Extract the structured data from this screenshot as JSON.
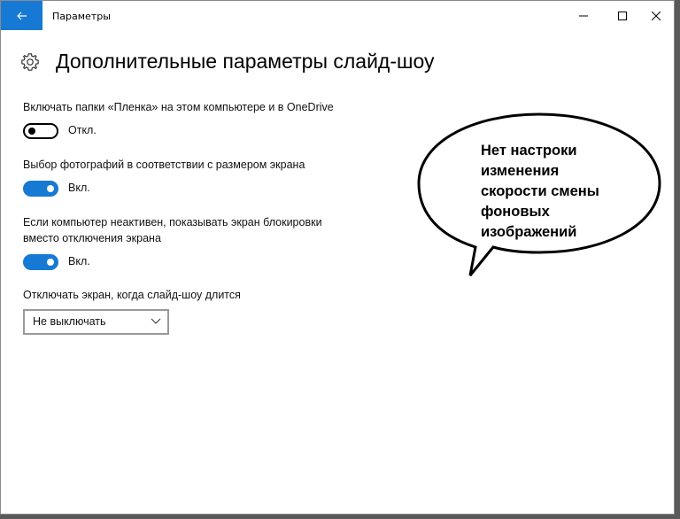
{
  "window": {
    "title": "Параметры"
  },
  "page": {
    "title": "Дополнительные параметры слайд-шоу"
  },
  "settings": [
    {
      "label": "Включать папки «Пленка» на этом компьютере и в OneDrive",
      "state": "Откл.",
      "on": false
    },
    {
      "label": "Выбор фотографий в соответствии с размером экрана",
      "state": "Вкл.",
      "on": true
    },
    {
      "label": "Если компьютер неактивен, показывать экран блокировки",
      "label2": "вместо отключения экрана",
      "state": "Вкл.",
      "on": true
    }
  ],
  "screen_off": {
    "label": "Отключать экран, когда слайд-шоу длится",
    "selected": "Не выключать"
  },
  "callout": {
    "lines": [
      "Нет настроки",
      "изменения",
      "скорости смены",
      "фоновых",
      "изображений"
    ]
  },
  "colors": {
    "accent": "#1679d4"
  }
}
